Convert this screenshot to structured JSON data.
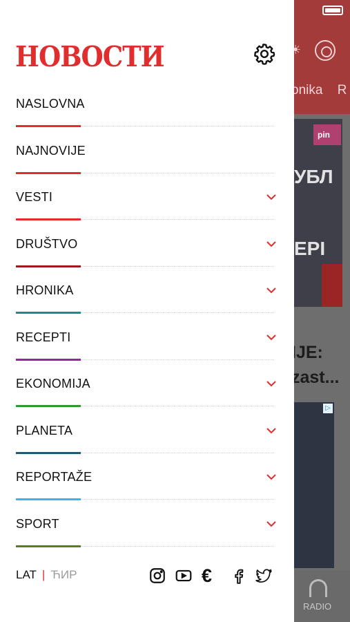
{
  "background": {
    "tabs": [
      "onika",
      "R"
    ],
    "headline_lines": [
      "IJE:",
      "zast..."
    ],
    "photo_text_1": "УБЛ",
    "photo_text_2": "EPI",
    "photo_badge": "pin",
    "bottom_nav_label": "RADIO"
  },
  "drawer": {
    "logo": "НОВОСТИ",
    "settings_icon": "gear-icon",
    "items": [
      {
        "label": "NASLOVNA",
        "color": "#e02d2d",
        "chevron": false
      },
      {
        "label": "NAJNOVIJE",
        "color": "#e02d2d",
        "chevron": false
      },
      {
        "label": "VESTI",
        "color": "#e02d2d",
        "chevron": true
      },
      {
        "label": "DRUŠTVO",
        "color": "#9e1a1a",
        "chevron": true
      },
      {
        "label": "HRONIKA",
        "color": "#1e8b8b",
        "chevron": true
      },
      {
        "label": "RECEPTI",
        "color": "#8e2a9c",
        "chevron": true
      },
      {
        "label": "EKONOMIJA",
        "color": "#2e9a2e",
        "chevron": true
      },
      {
        "label": "PLANETA",
        "color": "#1c5a7a",
        "chevron": true
      },
      {
        "label": "REPORTAŽE",
        "color": "#3cb4e6",
        "chevron": true
      },
      {
        "label": "SPORT",
        "color": "#5a7a2a",
        "chevron": true
      }
    ],
    "footer": {
      "lat": "LAT",
      "separator": "|",
      "cyr": "ЋИР",
      "euro": "€",
      "social_icons": [
        "instagram-icon",
        "youtube-icon",
        "euro-icon",
        "facebook-icon",
        "twitter-icon"
      ]
    }
  },
  "colors": {
    "accent": "#e02d2d"
  }
}
